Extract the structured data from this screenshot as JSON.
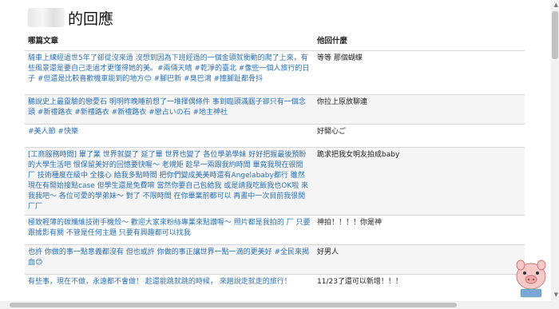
{
  "page": {
    "title_suffix": "的回應"
  },
  "columns": {
    "article": "哪篇文章",
    "reply": "他回什麼"
  },
  "rows": [
    {
      "article": "騎車上練經過世5年了郤從沒來過 沒想到因為下班經過的一個金頭就衝動的爬了上來，有些風景還是要自己走過才更懂得她的美。#兩倆天晴 #乾淨的臺北 #像些一個人旅行的日子 #但還是比較喜歡機車能到的地方😊 #腳巴新 #臭巴鴻 #撞腳趾都骨抖",
      "reply": "等等 那個蝴蝶"
    },
    {
      "article": "聽說史上最靈驗的戀愛石 明明昨晚睡前想了一堆擇偶條件 事到臨頭滿腦子卻只有一個念頭 #新禮路衣 #新禮路衣 #新禮路衣 #戀占いの石 #地主神社",
      "reply": "你拉上原放聊連"
    },
    {
      "article": "#美人節 #快樂",
      "reply": "好開心ご"
    },
    {
      "article": "[工商服務時間] 畢了業 世界就變了 延了畢 世界也變了 各位學弟學妹 好好把握最後預盼的大學生活吧 恨保留美好的回憶要快喔～ 老規矩 趁早一兩跟我約時間 畢竟我現在很閒 厂 技術種度在級中 全接心 給我多點時間 把你們變成美美時還有Angelababy都行 雖然現在有開始接點case 但學生還是免費唷 當然你要自己包給我 或是請我吃飯我也OK啦 來我我吧～ 各位可愛的學弟妹～ 對了 不限時間 在你畢業前都可以 再畫中一次目前我很閒 厂厂",
      "reply": "跪求把我女明友拍成baby"
    },
    {
      "article": "極致輕薄的碳纖維技術手機殼～ 歡迎大家來粉絲專業來點讚喔～ 照片都是我拍的 厂 只要跟據影有關 不管是任何主題 只要有興趣都可以找我",
      "reply": "神拍！！！！你是神"
    },
    {
      "article": "也許 你做的事一點意義都沒有 但也或許 你做的事正讓世界一點一滴的更美好 #全民來揭血😊",
      "reply": "好男人"
    },
    {
      "article": "有些事，現在不做，永遠都不會做！ 趁還能跳就跳的時候， 來趟說走就走的旅行！",
      "reply": "11/23了還可以新增！！！"
    }
  ]
}
